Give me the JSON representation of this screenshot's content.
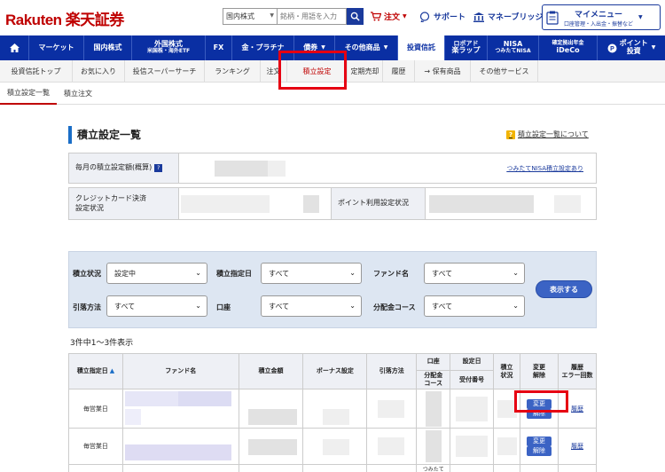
{
  "header": {
    "logo_text": "Rakuten 楽天証券",
    "search_category": "国内株式",
    "search_placeholder": "銘柄・用語を入力",
    "order_label": "注文",
    "support_label": "サポート",
    "bridge_label": "マネーブリッジ",
    "mymenu_title": "マイメニュー",
    "mymenu_sub": "口座管理・入出金・振替など"
  },
  "main_nav": [
    {
      "label": "マーケット"
    },
    {
      "label": "国内株式"
    },
    {
      "label": "外国株式",
      "sub": "米国株・海外ETF"
    },
    {
      "label": "FX"
    },
    {
      "label": "金・プラチナ"
    },
    {
      "label": "債券"
    },
    {
      "label": "その他商品"
    },
    {
      "label": "投資信託"
    },
    {
      "label": "ロボアド",
      "sub": "楽ラップ"
    },
    {
      "label": "NISA",
      "sub": "つみたてNISA"
    },
    {
      "label": "確定拠出年金",
      "sub": "iDeCo"
    },
    {
      "label": "ポイント",
      "sub": "投資"
    }
  ],
  "sub_nav": [
    {
      "label": "投資信託トップ"
    },
    {
      "label": "お気に入り"
    },
    {
      "label": "投信スーパーサーチ"
    },
    {
      "label": "ランキング"
    },
    {
      "label": "注文"
    },
    {
      "label": "積立設定"
    },
    {
      "label": "定期売却"
    },
    {
      "label": "履歴"
    },
    {
      "label": "→ 保有商品"
    },
    {
      "label": "その他サービス"
    }
  ],
  "third_nav": [
    {
      "label": "積立設定一覧"
    },
    {
      "label": "積立注文"
    }
  ],
  "page": {
    "title": "積立設定一覧",
    "help_label": "積立設定一覧について",
    "monthly_label": "毎月の積立設定額(概算)",
    "nisa_link": "つみたてNISA積立設定あり",
    "credit_label_1": "クレジットカード決済",
    "credit_label_2": "設定状況",
    "point_label": "ポイント利用設定状況"
  },
  "filter": {
    "status_label": "積立状況",
    "status_value": "設定中",
    "date_label": "積立指定日",
    "date_value": "すべて",
    "fund_label": "ファンド名",
    "fund_value": "すべて",
    "debit_label": "引落方法",
    "debit_value": "すべて",
    "account_label": "口座",
    "account_value": "すべて",
    "dist_label": "分配金コース",
    "dist_value": "すべて",
    "show_button": "表示する"
  },
  "results": {
    "count_text": "3件中1〜3件表示",
    "headers": {
      "date": "積立指定日",
      "fund": "ファンド名",
      "amount": "積立金額",
      "bonus": "ボーナス設定",
      "debit": "引落方法",
      "account": "口座",
      "dist": "分配金",
      "course": "コース",
      "setdate": "設定日",
      "receipt": "受付番号",
      "status1": "積立",
      "status2": "状況",
      "change1": "変更",
      "change2": "解除",
      "history1": "履歴",
      "history2": "エラー回数"
    },
    "rows": [
      {
        "date": "毎営業日",
        "change": "変更",
        "cancel": "解除",
        "history": "履歴"
      },
      {
        "date": "毎営業日",
        "change": "変更",
        "cancel": "解除",
        "history": "履歴"
      }
    ],
    "partial_text": "つみたて"
  }
}
